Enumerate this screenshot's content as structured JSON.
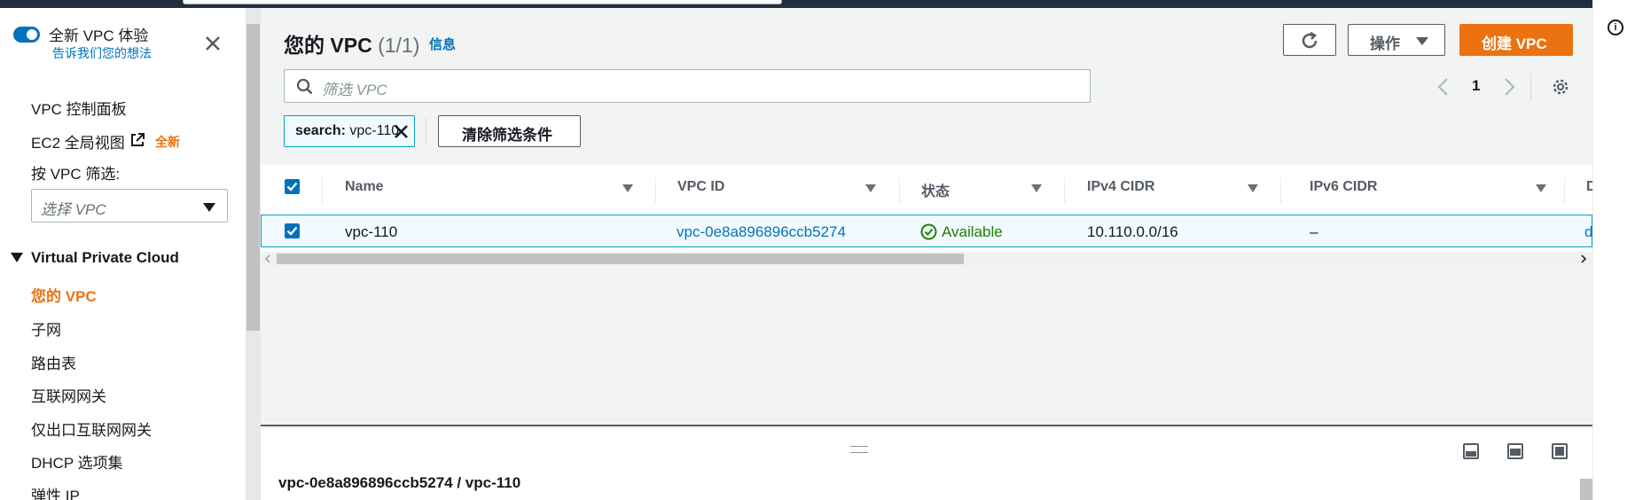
{
  "nav": {
    "toggle_label": "全新 VPC 体验",
    "feedback_link": "告诉我们您的想法",
    "dashboard": "VPC 控制面板",
    "ec2_global": "EC2 全局视图",
    "new_badge": "全新",
    "filter_label": "按 VPC 筛选:",
    "filter_placeholder": "选择 VPC",
    "section": "Virtual Private Cloud",
    "items": [
      "您的 VPC",
      "子网",
      "路由表",
      "互联网网关",
      "仅出口互联网网关",
      "DHCP 选项集",
      "弹性 IP"
    ]
  },
  "header": {
    "title": "您的 VPC",
    "count": "(1/1)",
    "info": "信息",
    "actions_label": "操作",
    "create_label": "创建 VPC"
  },
  "search": {
    "placeholder": "筛选 VPC",
    "token_key": "search:",
    "token_value": "vpc-110",
    "clear_label": "清除筛选条件"
  },
  "pagination": {
    "page": "1"
  },
  "table": {
    "columns": [
      "Name",
      "VPC ID",
      "状态",
      "IPv4 CIDR",
      "IPv6 CIDR",
      "D"
    ],
    "rows": [
      {
        "name": "vpc-110",
        "vpc_id": "vpc-0e8a896896ccb5274",
        "status": "Available",
        "ipv4": "10.110.0.0/16",
        "ipv6": "–",
        "next": "d"
      }
    ]
  },
  "details": {
    "title": "vpc-0e8a896896ccb5274 / vpc-110"
  },
  "colors": {
    "accent": "#ec7211",
    "link": "#0073bb",
    "success": "#1d8102"
  }
}
